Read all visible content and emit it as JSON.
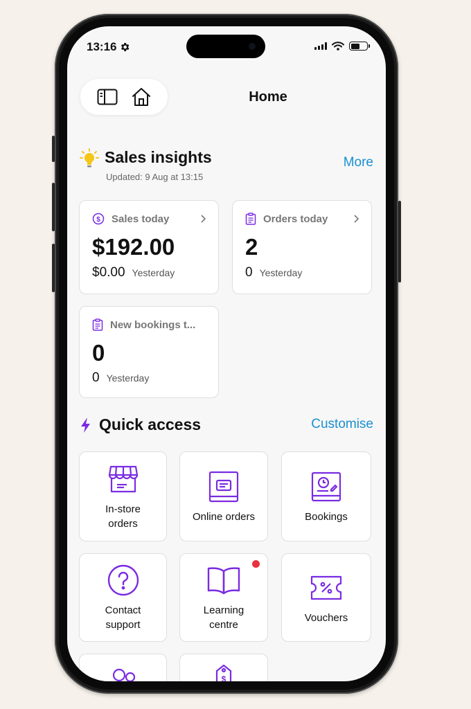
{
  "status": {
    "time": "13:16"
  },
  "header": {
    "title": "Home"
  },
  "insights": {
    "title": "Sales insights",
    "more_label": "More",
    "updated": "Updated: 9 Aug at 13:15",
    "cards": [
      {
        "label": "Sales today",
        "value": "$192.00",
        "prev_value": "$0.00",
        "prev_label": "Yesterday"
      },
      {
        "label": "Orders today",
        "value": "2",
        "prev_value": "0",
        "prev_label": "Yesterday"
      },
      {
        "label": "New bookings t...",
        "value": "0",
        "prev_value": "0",
        "prev_label": "Yesterday"
      }
    ]
  },
  "quick_access": {
    "title": "Quick access",
    "customise_label": "Customise",
    "tiles": [
      {
        "label": "In-store orders",
        "icon": "store-icon"
      },
      {
        "label": "Online orders",
        "icon": "online-orders-icon"
      },
      {
        "label": "Bookings",
        "icon": "bookings-icon"
      },
      {
        "label": "Contact support",
        "icon": "question-icon"
      },
      {
        "label": "Learning centre",
        "icon": "book-icon",
        "notification": true
      },
      {
        "label": "Vouchers",
        "icon": "voucher-icon"
      },
      {
        "label": "",
        "icon": "customers-icon"
      },
      {
        "label": "",
        "icon": "price-tag-icon"
      }
    ]
  },
  "colors": {
    "accent_purple": "#7a2be2",
    "link_blue": "#1a8fd0",
    "bulb_yellow": "#f5c518",
    "badge_red": "#e8323c"
  }
}
